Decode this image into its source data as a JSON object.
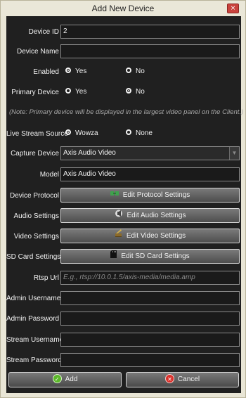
{
  "window": {
    "title": "Add New Device",
    "close_glyph": "×"
  },
  "form": {
    "device_id": {
      "label": "Device ID",
      "value": "2"
    },
    "device_name": {
      "label": "Device Name",
      "value": ""
    },
    "enabled": {
      "label": "Enabled",
      "options": [
        "Yes",
        "No"
      ],
      "selected": "Yes"
    },
    "primary_device": {
      "label": "Primary Device",
      "options": [
        "Yes",
        "No"
      ],
      "selected": "No"
    },
    "note": "(Note: Primary device will be displayed in the largest video panel on the Client.)",
    "live_stream_source": {
      "label": "Live Stream Source",
      "options": [
        "Wowza",
        "None"
      ],
      "selected": "Wowza"
    },
    "capture_device": {
      "label": "Capture Device",
      "value": "Axis Audio Video"
    },
    "model": {
      "label": "Model",
      "value": "Axis Audio Video"
    },
    "device_protocol": {
      "label": "Device Protocol",
      "button": "Edit Protocol Settings",
      "icon": "protocol-icon"
    },
    "audio_settings": {
      "label": "Audio Settings",
      "button": "Edit Audio Settings",
      "icon": "audio-icon"
    },
    "video_settings": {
      "label": "Video Settings",
      "button": "Edit Video Settings",
      "icon": "video-icon"
    },
    "sd_card_settings": {
      "label": "SD Card Settings",
      "button": "Edit SD Card Settings",
      "icon": "sd-card-icon"
    },
    "rtsp_url": {
      "label": "Rtsp Url",
      "placeholder": "E.g., rtsp://10.0.1.5/axis-media/media.amp"
    },
    "admin_username": {
      "label": "Admin Username",
      "value": ""
    },
    "admin_password": {
      "label": "Admin Password",
      "value": ""
    },
    "stream_username": {
      "label": "Stream Username",
      "value": ""
    },
    "stream_password": {
      "label": "Stream Password",
      "value": ""
    }
  },
  "footer": {
    "add_label": "Add",
    "cancel_label": "Cancel",
    "add_glyph": "✓",
    "cancel_glyph": "✕"
  },
  "colors": {
    "background": "#202020",
    "field_border": "#8a8a8a",
    "add_icon": "#5cb82a",
    "cancel_icon": "#d9312b",
    "protocol_icon": "#3fa34d"
  }
}
